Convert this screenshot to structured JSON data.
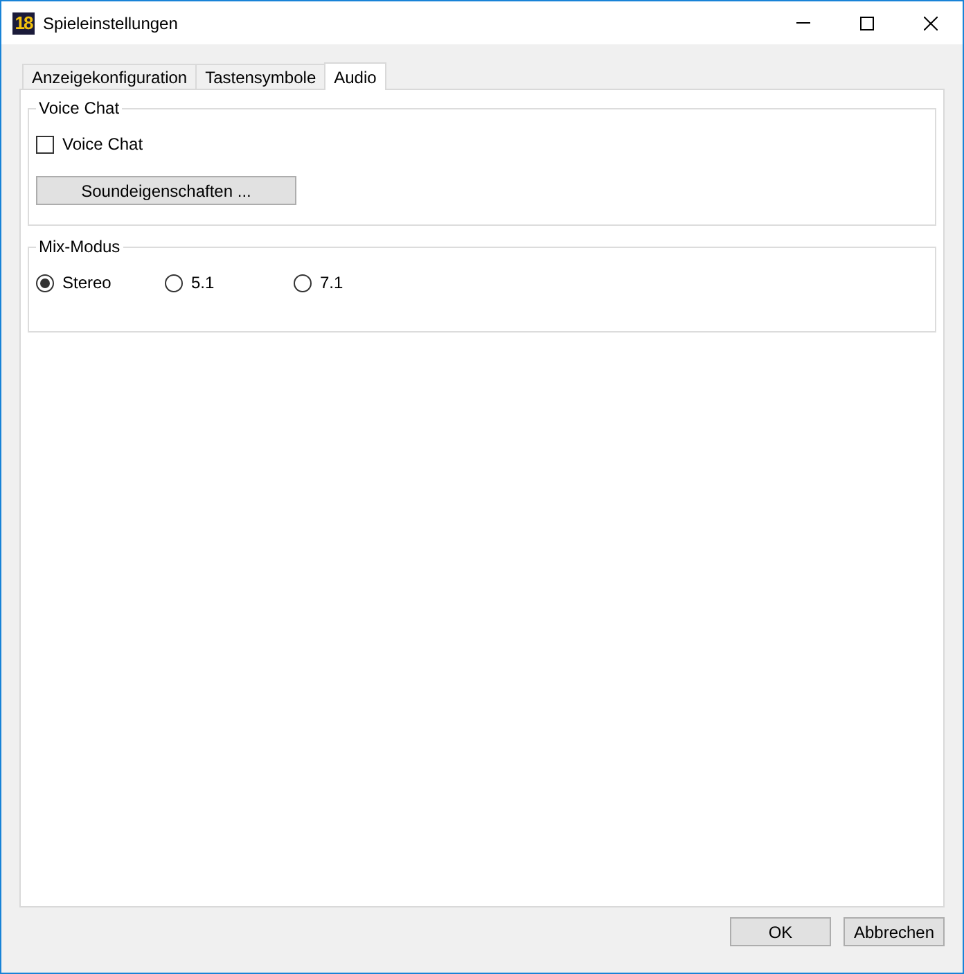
{
  "window": {
    "logo": "18",
    "title": "Spieleinstellungen"
  },
  "tabs": [
    {
      "label": "Anzeigekonfiguration",
      "selected": false
    },
    {
      "label": "Tastensymbole",
      "selected": false
    },
    {
      "label": "Audio",
      "selected": true
    }
  ],
  "voice_chat_group": {
    "title": "Voice Chat",
    "checkbox": {
      "label": "Voice Chat",
      "checked": false
    },
    "button": "Soundeigenschaften ..."
  },
  "mix_mode_group": {
    "title": "Mix-Modus",
    "options": [
      {
        "label": "Stereo",
        "selected": true
      },
      {
        "label": "5.1",
        "selected": false
      },
      {
        "label": "7.1",
        "selected": false
      }
    ]
  },
  "buttons": [
    "OK",
    "Abbrechen"
  ]
}
